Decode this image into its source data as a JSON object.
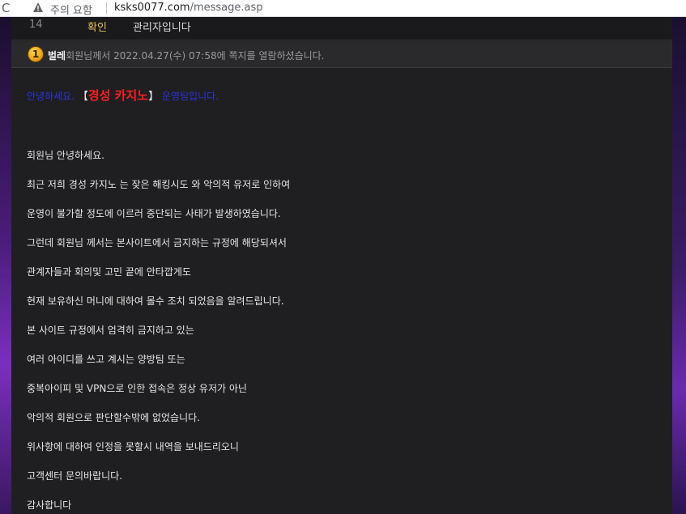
{
  "browser": {
    "reload_glyph": "C",
    "security_label": "주의 요함",
    "url_host": "ksks0077.com",
    "url_path": "/message.asp"
  },
  "list_row": {
    "number": "14",
    "status": "확인",
    "title": "관리자입니다"
  },
  "read_notice": {
    "rank_badge": "1",
    "nickname": "벌레",
    "text": "회원님께서 2022.04.27(수) 07:58에 쪽지를 열람하셨습니다."
  },
  "message": {
    "greeting_prefix": "안녕하세요.",
    "bracket_open": "【",
    "casino_name": "경성 카지노",
    "bracket_close": "】",
    "greeting_suffix": "운영팀입니다.",
    "lines": [
      "회원님 안녕하세요.",
      "최근 저희 경성 카지노 는 잦은 해킹시도 와 악의적 유저로 인하여",
      "운영이 불가할 정도에 이르러 중단되는 사태가 발생하였습니다.",
      "그런데 회원님 께서는 본사이트에서 금지하는 규정에 해당되셔서",
      "관계자들과 회의및 고민 끝에 안타깝게도",
      "현재 보유하신 머니에 대하여 몰수 조치 되었음을 알려드립니다.",
      "본 사이트 규정에서 엄격히 금지하고 있는",
      "여러 아이디를 쓰고 계시는 양방팀 또는",
      "중복아이피 및 VPN으로 인한 접속은 정상 유저가 아닌",
      "악의적 회원으로 판단할수밖에 없었습니다.",
      "위사항에 대하여 인정을 못할시 내역을 보내드리오니",
      "고객센터 문의바랍니다.",
      "감사합니다"
    ]
  },
  "colors": {
    "page_bg": "#1b1b1f",
    "greeting_blue": "#2a33d8",
    "casino_red": "#ff1f1f",
    "status_gold": "#e8c25a"
  }
}
